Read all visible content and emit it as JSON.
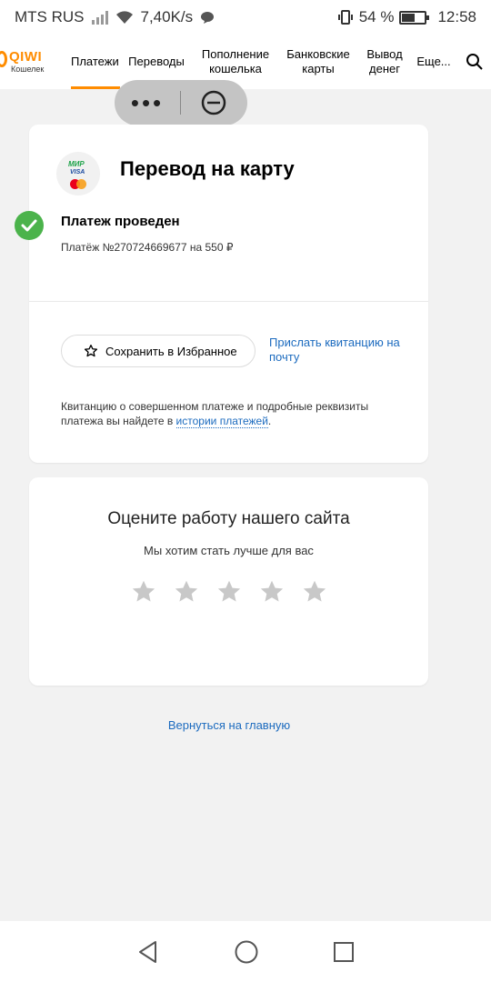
{
  "status_bar": {
    "carrier": "MTS RUS",
    "speed": "7,40K/s",
    "battery": "54 %",
    "battery_level": 0.54,
    "time": "12:58"
  },
  "header": {
    "logo_text": "QIWI",
    "logo_sub": "Кошелек",
    "nav": [
      {
        "label": "Платежи",
        "active": true
      },
      {
        "label": "Переводы"
      },
      {
        "label": "Пополнение кошелька"
      },
      {
        "label": "Банковские карты"
      },
      {
        "label": "Вывод денег"
      },
      {
        "label": "Еще..."
      }
    ]
  },
  "receipt": {
    "card_logo_mir": "МИР",
    "card_logo_visa": "VISA",
    "title": "Перевод на карту",
    "status": "Платеж проведен",
    "payment_line": "Платёж №270724669677 на 550 ₽",
    "favorite_button": "Сохранить в Избранное",
    "receipt_link": "Прислать квитанцию на почту",
    "note_prefix": "Квитанцию о совершенном платеже и подробные реквизиты платежа вы найдете в ",
    "note_link": "истории платежей",
    "note_suffix": "."
  },
  "rating": {
    "title": "Оцените работу нашего сайта",
    "subtitle": "Мы хотим стать лучше для вас",
    "stars_total": 5,
    "stars_selected": 0
  },
  "back_link": "Вернуться на главную",
  "colors": {
    "accent": "#ff8c00",
    "link": "#1c6bbf",
    "success": "#4bb34b"
  }
}
